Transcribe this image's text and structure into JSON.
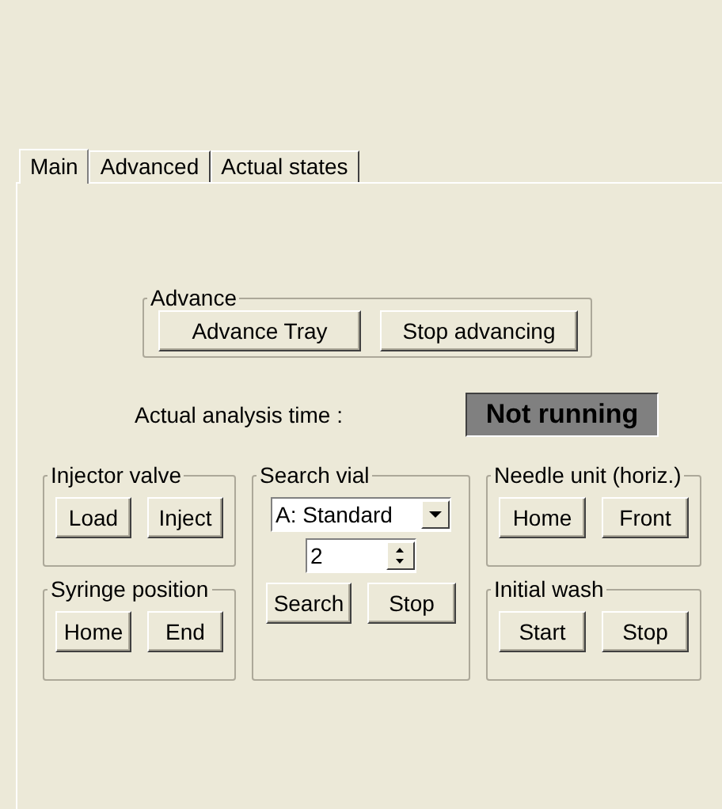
{
  "tabs": [
    {
      "label": "Main",
      "selected": true
    },
    {
      "label": "Advanced",
      "selected": false
    },
    {
      "label": "Actual states",
      "selected": false
    }
  ],
  "advance": {
    "title": "Advance",
    "buttons": [
      "Advance Tray",
      "Stop advancing"
    ]
  },
  "analysis_time": {
    "label": "Actual analysis time :",
    "value": "Not running"
  },
  "injector_valve": {
    "title": "Injector valve",
    "buttons": [
      "Load",
      "Inject"
    ]
  },
  "syringe_position": {
    "title": "Syringe position",
    "buttons": [
      "Home",
      "End"
    ]
  },
  "search_vial": {
    "title": "Search vial",
    "tray": "A: Standard",
    "vial": "2",
    "buttons": [
      "Search",
      "Stop"
    ]
  },
  "needle_unit": {
    "title": "Needle unit (horiz.)",
    "buttons": [
      "Home",
      "Front"
    ]
  },
  "initial_wash": {
    "title": "Initial wash",
    "buttons": [
      "Start",
      "Stop"
    ]
  }
}
